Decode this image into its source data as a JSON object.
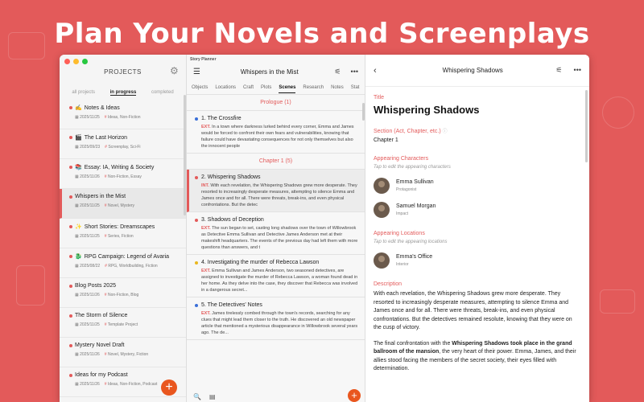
{
  "headline": "Plan Your Novels and Screenplays",
  "colors": {
    "accent": "#e35a5a",
    "fab": "#e9561e"
  },
  "projects_panel": {
    "title": "PROJECTS",
    "tabs": [
      "all projects",
      "in progress",
      "completed"
    ],
    "active_tab": "in progress",
    "items": [
      {
        "name": "Notes & Ideas",
        "emoji": "✍️",
        "date": "2025/11/25",
        "tags": "Ideas, Non-Fiction"
      },
      {
        "name": "The Last Horizon",
        "emoji": "🎬",
        "date": "2025/09/23",
        "tags": "Screenplay, Sci-Fi"
      },
      {
        "name": "Essay: IA, Writing & Society",
        "emoji": "📚",
        "date": "2025/11/26",
        "tags": "Non-Fiction, Essay"
      },
      {
        "name": "Whispers in the Mist",
        "emoji": "",
        "date": "2025/11/25",
        "tags": "Novel, Mystery"
      },
      {
        "name": "Short Stories: Dreamscapes",
        "emoji": "✨",
        "date": "2025/11/25",
        "tags": "Series, Fiction"
      },
      {
        "name": "RPG Campaign: Legend of Avaria",
        "emoji": "🐉",
        "date": "2025/08/22",
        "tags": "RPG, Worldbuilding, Fiction"
      },
      {
        "name": "Blog Posts 2025",
        "emoji": "",
        "date": "2025/11/26",
        "tags": "Non-Fiction, Blog"
      },
      {
        "name": "The Storm of Silence",
        "emoji": "",
        "date": "2025/11/25",
        "tags": "Template Project"
      },
      {
        "name": "Mystery Novel Draft",
        "emoji": "",
        "date": "2025/11/26",
        "tags": "Novel, Mystery, Fiction"
      },
      {
        "name": "Ideas for my Podcast",
        "emoji": "",
        "date": "2025/11/26",
        "tags": "Ideas, Non-Fiction, Podcast"
      }
    ],
    "add_label": "+"
  },
  "scenes_panel": {
    "app_label": "Story Planner",
    "title": "Whispers in the Mist",
    "tabs": [
      "Objects",
      "Locations",
      "Craft",
      "Plots",
      "Scenes",
      "Research",
      "Notes",
      "Stat"
    ],
    "active_tab": "Scenes",
    "sections": [
      {
        "heading": "Prologue (1)",
        "scenes": [
          {
            "title": "1. The Crossfire",
            "dot": "#3a6fd8",
            "loc": "EXT.",
            "text": "In a town where darkness lurked behind every corner, Emma and James would be forced to confront their own fears and vulnerabilities, knowing that failure could have devastating consequences for not only themselves but also the innocent people"
          }
        ]
      },
      {
        "heading": "Chapter 1 (5)",
        "scenes": [
          {
            "title": "2. Whispering Shadows",
            "dot": "#e35a5a",
            "loc": "INT.",
            "text": "With each revelation, the Whispering Shadows grew more desperate. They resorted to increasingly desperate measures, attempting to silence Emma and James once and for all. There were threats, break-ins, and even physical confrontations. But the detec"
          },
          {
            "title": "3. Shadows of Deception",
            "dot": "#e35a5a",
            "loc": "EXT.",
            "text": "The sun began to set, casting long shadows over the town of Willowbrook as Detective Emma Sullivan and Detective James Anderson met at their makeshift headquarters. The events of the previous day had left them with more questions than answers, and t"
          },
          {
            "title": "4. Investigating the murder of Rebecca Lawson",
            "dot": "#e9b71e",
            "loc": "EXT.",
            "text": "Emma Sullivan and James Anderson, two seasoned detectives, are assigned to investigate the murder of Rebecca Lawson, a woman found dead in her home. As they delve into the case, they discover that Rebecca was involved in a dangerous secret..."
          },
          {
            "title": "5. The Detectives' Notes",
            "dot": "#3a6fd8",
            "loc": "EXT.",
            "text": "James tirelessly combed through the town's records, searching for any clues that might lead them closer to the truth. He discovered an old newspaper article that mentioned a mysterious disappearance in Willowbrook several years ago. The de..."
          }
        ]
      }
    ]
  },
  "detail_panel": {
    "title": "Whispering Shadows",
    "title_label": "Title",
    "title_value": "Whispering Shadows",
    "section_label": "Section (Act, Chapter, etc.)",
    "section_value": "Chapter 1",
    "characters_label": "Appearing Characters",
    "characters_hint": "Tap to edit the appearing characters",
    "characters": [
      {
        "name": "Emma Sullivan",
        "role": "Protagonist"
      },
      {
        "name": "Samuel Morgan",
        "role": "Impact"
      }
    ],
    "locations_label": "Appearing Locations",
    "locations_hint": "Tap to edit the appearing locations",
    "locations": [
      {
        "name": "Emma's Office",
        "role": "Interior"
      }
    ],
    "description_label": "Description",
    "description_p1": "With each revelation, the Whispering Shadows grew more desperate. They resorted to increasingly desperate measures, attempting to silence Emma and James once and for all. There were threats, break-ins, and even physical confrontations. But the detectives remained resolute, knowing that they were on the cusp of victory.",
    "description_p2_a": "The final confrontation with the ",
    "description_p2_b": "Whispering Shadows took place in the grand ballroom of the mansion",
    "description_p2_c": ", the very heart of their power. Emma, James, and their allies stood facing the members of the secret society, their eyes filled with determination."
  }
}
